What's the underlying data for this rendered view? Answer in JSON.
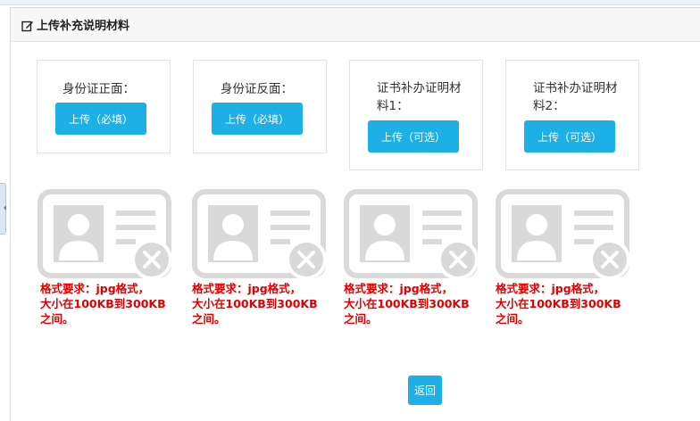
{
  "panel": {
    "title": "上传补充说明材料"
  },
  "uploads": [
    {
      "label": "身份证正面：",
      "button": "上传（必填）"
    },
    {
      "label": "身份证反面：",
      "button": "上传（必填）"
    },
    {
      "label_line1": "证书补办证明材",
      "label_line2": "料1：",
      "button": "上传（可选）"
    },
    {
      "label_line1": "证书补办证明材",
      "label_line2": "料2：",
      "button": "上传（可选）"
    }
  ],
  "requirements": [
    {
      "line1": "格式要求：jpg格式，",
      "line2": "大小在100KB到300KB",
      "line3": "之间。"
    },
    {
      "line1": "格式要求：jpg格式，",
      "line2": "大小在100KB到300KB",
      "line3": "之间。"
    },
    {
      "line1": "格式要求：jpg格式，",
      "line2": "大小在100KB到300KB",
      "line3": "之间。"
    },
    {
      "line1": "格式要求：jpg格式，",
      "line2": "大小在100KB到300KB",
      "line3": "之间。"
    }
  ],
  "back_button": "返回",
  "colors": {
    "button_blue": "#1cb0e6",
    "requirement_red": "#e00000",
    "placeholder_gray": "#d9d9d9"
  },
  "icons": {
    "header": "edit-icon",
    "placeholder": "id-card-missing-icon"
  }
}
